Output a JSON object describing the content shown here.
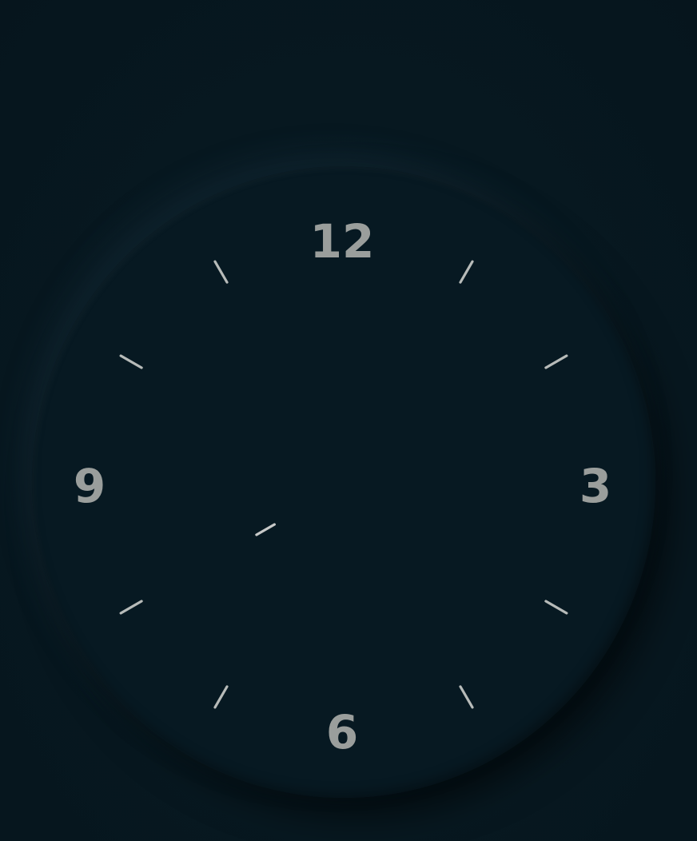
{
  "clock": {
    "numerals": {
      "twelve": "12",
      "three": "3",
      "six": "6",
      "nine": "9"
    },
    "hour_ticks": [
      1,
      2,
      4,
      5,
      7,
      8,
      10,
      11
    ],
    "hand_visible_position_hours": 8.0
  },
  "colors": {
    "background": "#071821",
    "face": "#071922",
    "numeral": "#9a9e9c",
    "tick": "#b7bbb9"
  }
}
